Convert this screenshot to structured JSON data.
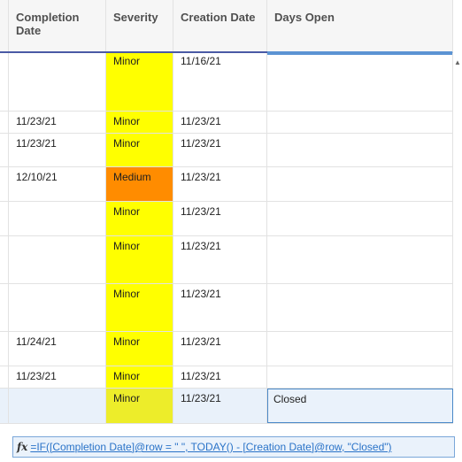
{
  "columns": {
    "completion_date": "Completion Date",
    "severity": "Severity",
    "creation_date": "Creation Date",
    "days_open": "Days Open"
  },
  "rows": [
    {
      "completion": "",
      "severity": "Minor",
      "creation": "11/16/21",
      "days_open": ""
    },
    {
      "completion": "11/23/21",
      "severity": "Minor",
      "creation": "11/23/21",
      "days_open": ""
    },
    {
      "completion": "11/23/21",
      "severity": "Minor",
      "creation": "11/23/21",
      "days_open": ""
    },
    {
      "completion": "12/10/21",
      "severity": "Medium",
      "creation": "11/23/21",
      "days_open": ""
    },
    {
      "completion": "",
      "severity": "Minor",
      "creation": "11/23/21",
      "days_open": ""
    },
    {
      "completion": "",
      "severity": "Minor",
      "creation": "11/23/21",
      "days_open": ""
    },
    {
      "completion": "",
      "severity": "Minor",
      "creation": "11/23/21",
      "days_open": ""
    },
    {
      "completion": "11/24/21",
      "severity": "Minor",
      "creation": "11/23/21",
      "days_open": ""
    },
    {
      "completion": "11/23/21",
      "severity": "Minor",
      "creation": "11/23/21",
      "days_open": ""
    },
    {
      "completion": "",
      "severity": "Minor",
      "creation": "11/23/21",
      "days_open": "Closed"
    }
  ],
  "formula_bar": {
    "icon": "fx-icon",
    "text": "=IF([Completion Date]@row = \" \", TODAY() - [Creation Date]@row, \"Closed\")"
  },
  "colors": {
    "minor": "#ffff00",
    "medium": "#ff8c00",
    "header_accent": "#4a5aa5",
    "selection": "#5b93d3"
  }
}
